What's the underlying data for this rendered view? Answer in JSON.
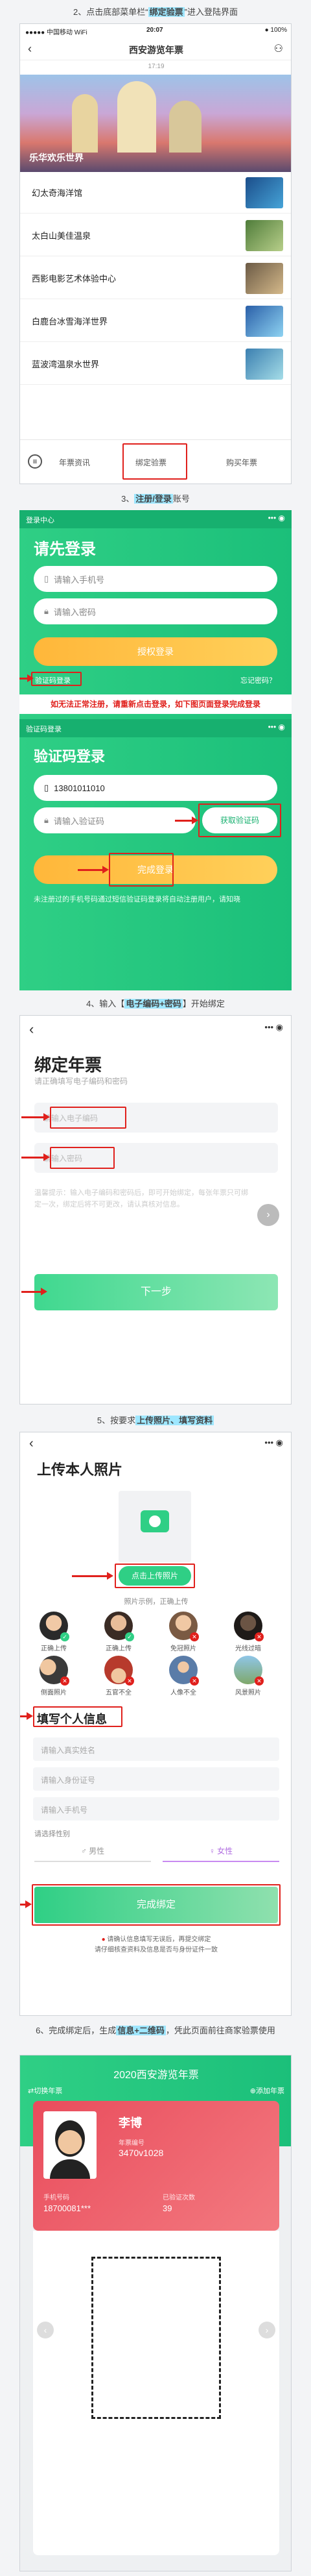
{
  "s2": {
    "caption_pre": "2、点击底部菜单栏“",
    "caption_hl": "绑定验票",
    "caption_post": "”进入登陆界面",
    "status_left": "●●●●● 中国移动 WiFi",
    "status_time": "20:07",
    "status_right": "● 100%",
    "nav_title": "西安游览年票",
    "time_small": "17:19",
    "banner_text": "乐华欢乐世界",
    "list": [
      "幻太奇海洋馆",
      "太白山美佳温泉",
      "西影电影艺术体验中心",
      "白鹿台冰雪海洋世界",
      "蓝波湾温泉水世界"
    ],
    "tab_news": "年票资讯",
    "tab_bind": "绑定验票",
    "tab_buy": "购买年票"
  },
  "s3": {
    "caption_pre": "3、",
    "caption_hl": "注册/登录",
    "caption_post": "账号",
    "topbar_title": "登录中心",
    "title": "请先登录",
    "phone_placeholder": "请输入手机号",
    "pwd_placeholder": "请输入密码",
    "login_btn": "授权登录",
    "sms_link": "验证码登录",
    "forgot_link": "忘记密码？",
    "midnote": "如无法正常注册，请重新点击登录，如下图页面登录完成登录",
    "topbar2_title": "验证码登录",
    "title2": "验证码登录",
    "phone_value": "13801011010",
    "code_placeholder": "请输入验证码",
    "get_code": "获取验证码",
    "done_btn": "完成登录",
    "footer_note": "未注册过的手机号码通过短信验证码登录将自动注册用户，请知晓"
  },
  "s4": {
    "caption_pre": "4、输入【",
    "caption_hl": "电子编码+密码",
    "caption_post": "】开始绑定",
    "title": "绑定年票",
    "subtitle": "请正确填写电子编码和密码",
    "code_placeholder": "请输入电子编码",
    "pwd_placeholder": "请输入密码",
    "desc": "温馨提示：输入电子编码和密码后，即可开始绑定，每张年票只可绑定一次，绑定后将不可更改，请认真核对信息。",
    "next_btn": "下一步"
  },
  "s5": {
    "caption_pre": "5、按要求",
    "caption_hl": "上传照片、填写资料",
    "caption_post": "",
    "title": "上传本人照片",
    "upload_btn": "点击上传照片",
    "sample_title": "照片示例，正确上传",
    "sample_labels": [
      "正确上传",
      "正确上传",
      "免冠照片",
      "光线过暗",
      "侧面照片",
      "五官不全",
      "人像不全",
      "风景照片"
    ],
    "info_title": "填写个人信息",
    "name_placeholder": "请输入真实姓名",
    "id_placeholder": "请输入身份证号",
    "phone_placeholder": "请输入手机号",
    "gender_label": "请选择性别",
    "gender_male": "男性",
    "gender_female": "女性",
    "submit_btn": "完成绑定",
    "warn": "请确认信息填写无误后，再提交绑定",
    "warn2": "请仔细核查资料及信息是否与身份证件一致"
  },
  "s6": {
    "caption_pre": "6、完成绑定后，生成",
    "caption_hl": "信息+二维码",
    "caption_post": "，凭此页面前往商家验票使用",
    "header_title": "2020西安游览年票",
    "switch_label": "⇄切换年票",
    "add_label": "⊕添加年票",
    "name": "李博",
    "code_label": "年票编号",
    "code_value": "3470v1028",
    "phone_label": "手机号码",
    "phone_value": "18700081***",
    "count_label": "已验证次数",
    "count_value": "39"
  }
}
